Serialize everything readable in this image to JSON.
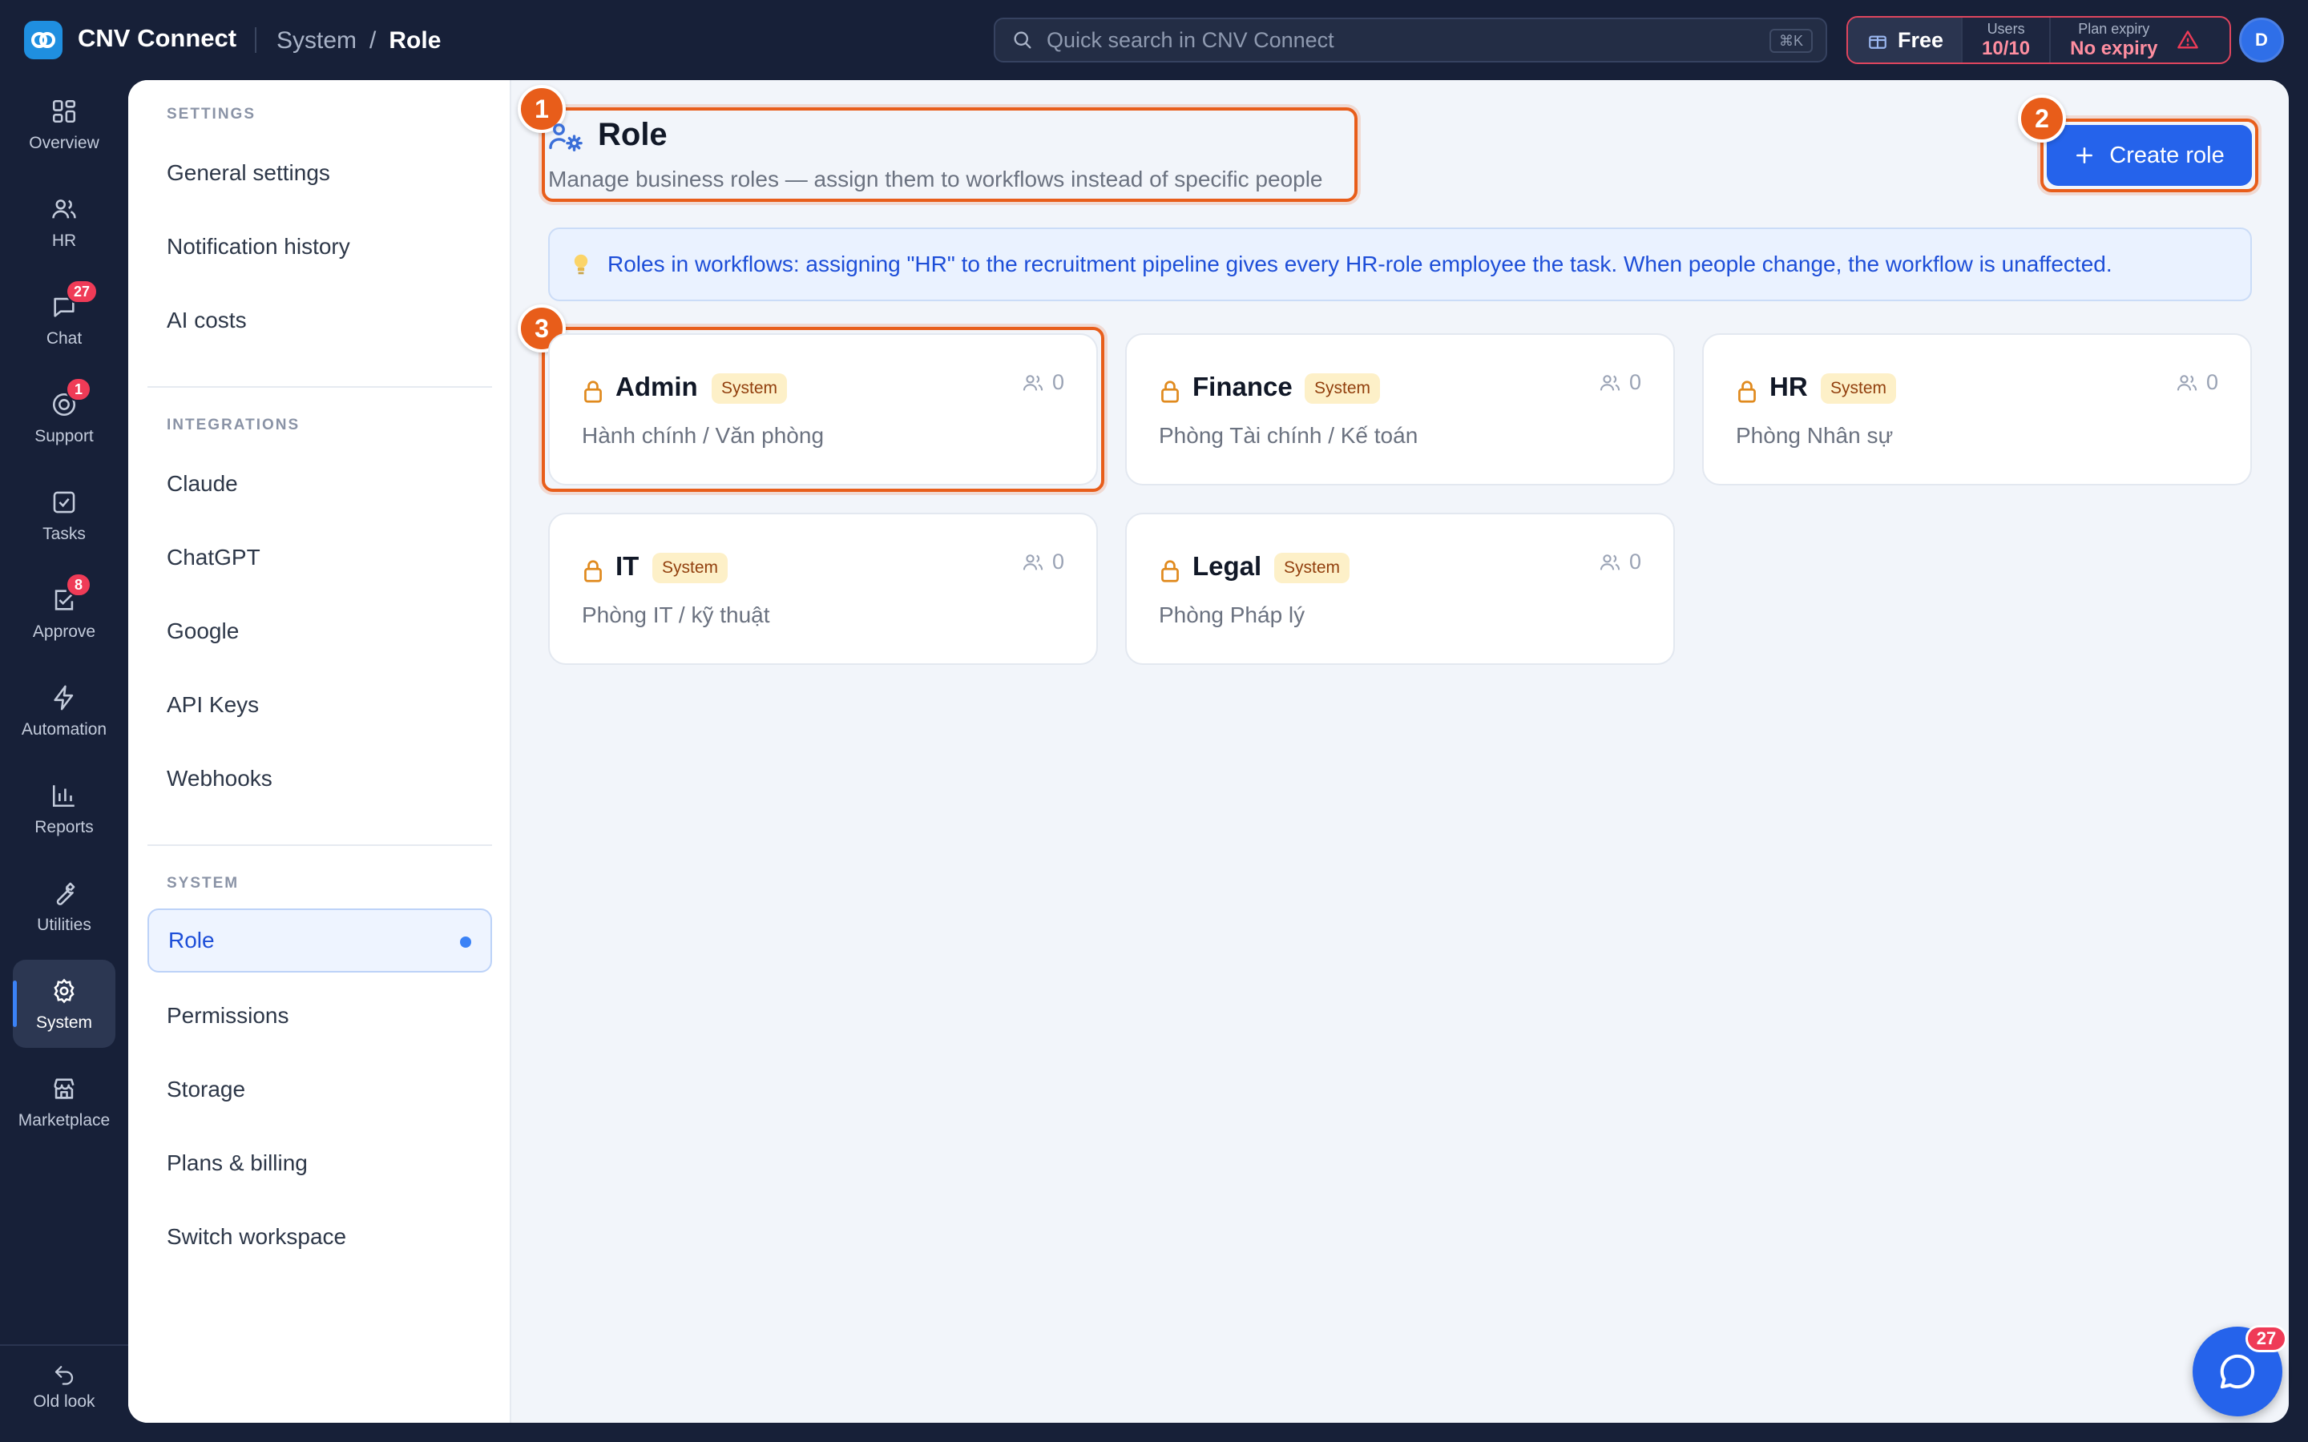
{
  "app": {
    "name": "CNV Connect"
  },
  "breadcrumb": [
    "System",
    "Role"
  ],
  "breadcrumb_sep": "/",
  "search": {
    "placeholder": "Quick search in CNV Connect",
    "shortcut": "⌘K"
  },
  "plan": {
    "name": "Free",
    "users_label": "Users",
    "users_value": "10/10",
    "expiry_label": "Plan expiry",
    "expiry_value": "No expiry"
  },
  "user": {
    "initial": "D"
  },
  "rail": [
    {
      "label": "Overview",
      "icon": "grid-icon"
    },
    {
      "label": "HR",
      "icon": "users-icon"
    },
    {
      "label": "Chat",
      "icon": "chat-icon",
      "badge": "27"
    },
    {
      "label": "Support",
      "icon": "support-icon",
      "badge": "1"
    },
    {
      "label": "Tasks",
      "icon": "checkbox-icon"
    },
    {
      "label": "Approve",
      "icon": "approve-icon",
      "badge": "8"
    },
    {
      "label": "Automation",
      "icon": "bolt-icon"
    },
    {
      "label": "Reports",
      "icon": "bar-chart-icon"
    },
    {
      "label": "Utilities",
      "icon": "wrench-icon"
    },
    {
      "label": "System",
      "icon": "gear-icon",
      "active": true
    },
    {
      "label": "Marketplace",
      "icon": "store-icon"
    }
  ],
  "old_look": "Old look",
  "subnav": {
    "settings_title": "SETTINGS",
    "settings_items": [
      "General settings",
      "Notification history",
      "AI costs"
    ],
    "integrations_title": "INTEGRATIONS",
    "integrations_items": [
      "Claude",
      "ChatGPT",
      "Google",
      "API Keys",
      "Webhooks"
    ],
    "system_title": "SYSTEM",
    "system_items": [
      "Role",
      "Permissions",
      "Storage",
      "Plans & billing",
      "Switch workspace"
    ]
  },
  "page": {
    "title": "Role",
    "subtitle": "Manage business roles — assign them to workflows instead of specific people",
    "create_button": "Create role",
    "info": "Roles in workflows: assigning \"HR\" to the recruitment pipeline gives every HR-role employee the task. When people change, the workflow is unaffected."
  },
  "markers": [
    "1",
    "2",
    "3"
  ],
  "roles": [
    {
      "name": "Admin",
      "tag": "System",
      "members": "0",
      "desc": "Hành chính / Văn phòng"
    },
    {
      "name": "Finance",
      "tag": "System",
      "members": "0",
      "desc": "Phòng Tài chính / Kế toán"
    },
    {
      "name": "HR",
      "tag": "System",
      "members": "0",
      "desc": "Phòng Nhân sự"
    },
    {
      "name": "IT",
      "tag": "System",
      "members": "0",
      "desc": "Phòng IT / kỹ thuật"
    },
    {
      "name": "Legal",
      "tag": "System",
      "members": "0",
      "desc": "Phòng Pháp lý"
    }
  ],
  "chat_badge": "27",
  "colors": {
    "accent": "#2563eb",
    "highlight": "#e85d1a",
    "badge": "#ef3b57",
    "rail_bg": "#172038"
  }
}
